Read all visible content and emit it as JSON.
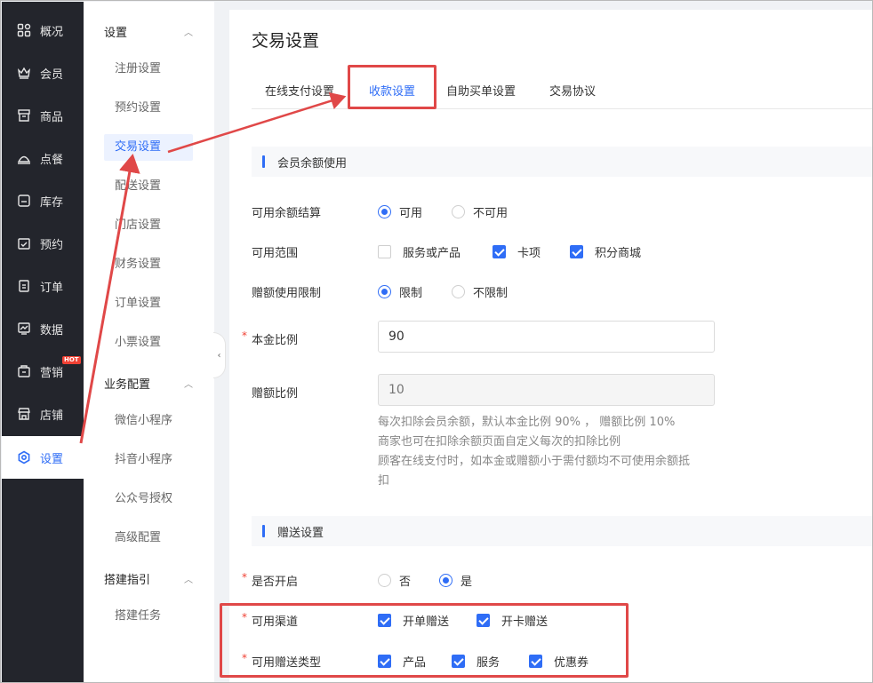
{
  "nav": {
    "items": [
      {
        "label": "概况",
        "icon": "grid-icon"
      },
      {
        "label": "会员",
        "icon": "crown-icon"
      },
      {
        "label": "商品",
        "icon": "shop-icon"
      },
      {
        "label": "点餐",
        "icon": "dish-cover-icon"
      },
      {
        "label": "库存",
        "icon": "inventory-icon"
      },
      {
        "label": "预约",
        "icon": "calendar-check-icon"
      },
      {
        "label": "订单",
        "icon": "clipboard-icon"
      },
      {
        "label": "数据",
        "icon": "chart-icon"
      },
      {
        "label": "营销",
        "icon": "marketing-icon",
        "badge": "HOT"
      },
      {
        "label": "店铺",
        "icon": "store-icon"
      },
      {
        "label": "设置",
        "icon": "settings-icon",
        "active": true
      }
    ]
  },
  "submenu": {
    "groups": [
      {
        "title": "设置",
        "items": [
          "注册设置",
          "预约设置",
          "交易设置",
          "配送设置",
          "门店设置",
          "财务设置",
          "订单设置",
          "小票设置"
        ]
      },
      {
        "title": "业务配置",
        "items": [
          "微信小程序",
          "抖音小程序",
          "公众号授权",
          "高级配置"
        ]
      },
      {
        "title": "搭建指引",
        "items": [
          "搭建任务"
        ]
      }
    ],
    "partial": {
      "peisong": "配送设置",
      "mendian": "门店设置"
    }
  },
  "main": {
    "title": "交易设置",
    "tabs": [
      "在线支付设置",
      "收款设置",
      "自助买单设置",
      "交易协议"
    ],
    "active_tab": "收款设置",
    "section1": "会员余额使用",
    "balance_settle": {
      "label": "可用余额结算",
      "options": [
        "可用",
        "不可用"
      ],
      "selected": "可用"
    },
    "scope": {
      "label": "可用范围",
      "options": [
        {
          "label": "服务或产品",
          "checked": false
        },
        {
          "label": "卡项",
          "checked": true
        },
        {
          "label": "积分商城",
          "checked": true
        }
      ]
    },
    "gift_limit": {
      "label": "赠额使用限制",
      "options": [
        "限制",
        "不限制"
      ],
      "selected": "限制"
    },
    "principal_ratio": {
      "label": "本金比例",
      "value": "90",
      "required": true
    },
    "gift_ratio": {
      "label": "赠额比例",
      "placeholder": "10",
      "disabled": true
    },
    "help_lines": [
      "每次扣除会员余额，默认本金比例 90% ， 赠额比例 10%",
      "商家也可在扣除余额页面自定义每次的扣除比例",
      "顾客在线支付时，如本金或赠额小于需付额均不可使用余额抵",
      "扣"
    ],
    "section2": "赠送设置",
    "enable": {
      "label": "是否开启",
      "options": [
        "否",
        "是"
      ],
      "selected": "是",
      "required": true
    },
    "channels": {
      "label": "可用渠道",
      "required": true,
      "options": [
        {
          "label": "开单赠送",
          "checked": true
        },
        {
          "label": "开卡赠送",
          "checked": true
        }
      ]
    },
    "gift_types": {
      "label": "可用赠送类型",
      "required": true,
      "options": [
        {
          "label": "产品",
          "checked": true
        },
        {
          "label": "服务",
          "checked": true
        },
        {
          "label": "优惠券",
          "checked": true
        }
      ]
    },
    "required_mark": "*"
  },
  "colors": {
    "accent": "#2f6df6",
    "annotation": "#e04848",
    "nav_bg": "#23252c"
  }
}
